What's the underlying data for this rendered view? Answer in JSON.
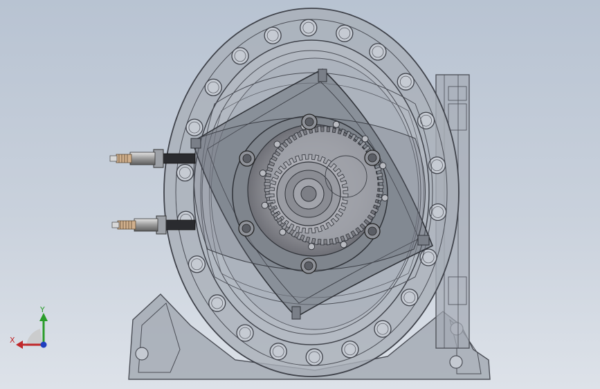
{
  "viewport": {
    "background_top": "#b8c3d2",
    "background_bottom": "#dde2e9"
  },
  "triad": {
    "x_label": "X",
    "y_label": "Y",
    "x_color": "#c0282b",
    "y_color": "#2a9d2a",
    "z_color": "#1f3fbf"
  },
  "model": {
    "icon": "rotary-engine-housing",
    "spark_plug_count": 2,
    "rotor_lobes": 3
  }
}
